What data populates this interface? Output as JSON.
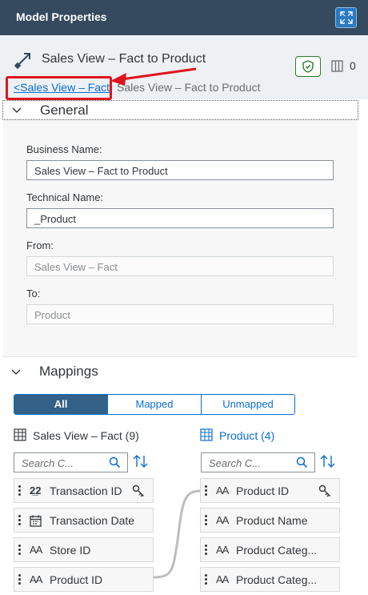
{
  "panel": {
    "title": "Model Properties"
  },
  "object": {
    "name": "Sales View – Fact to Product",
    "column_count": "0"
  },
  "breadcrumb": {
    "link": "<Sales View – Fact",
    "current": "Sales View – Fact to Product"
  },
  "general": {
    "heading": "General",
    "business_name_label": "Business Name:",
    "business_name_value": "Sales View – Fact to Product",
    "technical_name_label": "Technical Name:",
    "technical_name_value": "_Product",
    "from_label": "From:",
    "from_value": "Sales View – Fact",
    "to_label": "To:",
    "to_value": "Product"
  },
  "mappings": {
    "heading": "Mappings",
    "segments": [
      "All",
      "Mapped",
      "Unmapped"
    ],
    "source_table": "Sales View – Fact (9)",
    "target_table": "Product (4)",
    "search_placeholder": "Search C...",
    "source_columns": [
      {
        "icon": "2​2",
        "label": "Transaction ID",
        "key": true
      },
      {
        "icon": "calendar",
        "label": "Transaction Date",
        "key": false
      },
      {
        "icon": "AA",
        "label": "Store ID",
        "key": false
      },
      {
        "icon": "AA",
        "label": "Product ID",
        "key": false
      }
    ],
    "target_columns": [
      {
        "icon": "AA",
        "label": "Product ID",
        "key": true
      },
      {
        "icon": "AA",
        "label": "Product Name",
        "key": false
      },
      {
        "icon": "AA",
        "label": "Product Categ...",
        "key": false
      },
      {
        "icon": "AA",
        "label": "Product Categ...",
        "key": false
      }
    ]
  },
  "colors": {
    "header": "#354a5f",
    "accent": "#0a6ed1",
    "highlight": "#e0141e",
    "positive": "#2b7c2b"
  }
}
